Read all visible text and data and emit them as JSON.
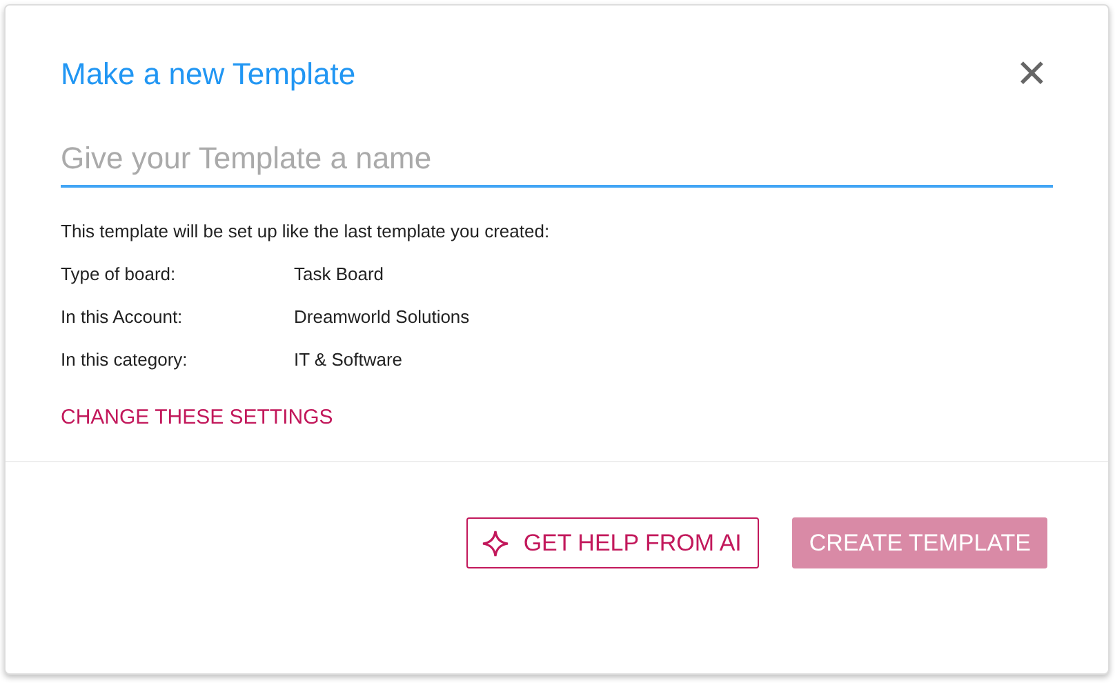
{
  "dialog": {
    "title": "Make a new Template",
    "close_label": "✕"
  },
  "name_field": {
    "placeholder": "Give your Template a name"
  },
  "intro": "This template will be set up like the last template you created:",
  "settings": [
    {
      "label": "Type of board:",
      "value": "Task Board"
    },
    {
      "label": "In this Account:",
      "value": "Dreamworld Solutions"
    },
    {
      "label": "In this category:",
      "value": "IT & Software"
    }
  ],
  "change_link": "CHANGE THESE SETTINGS",
  "buttons": [
    {
      "kind": "outline",
      "label": "GET HELP FROM AI",
      "disabled": false
    },
    {
      "kind": "filled",
      "label": "CREATE TEMPLATE",
      "disabled": true
    }
  ]
}
